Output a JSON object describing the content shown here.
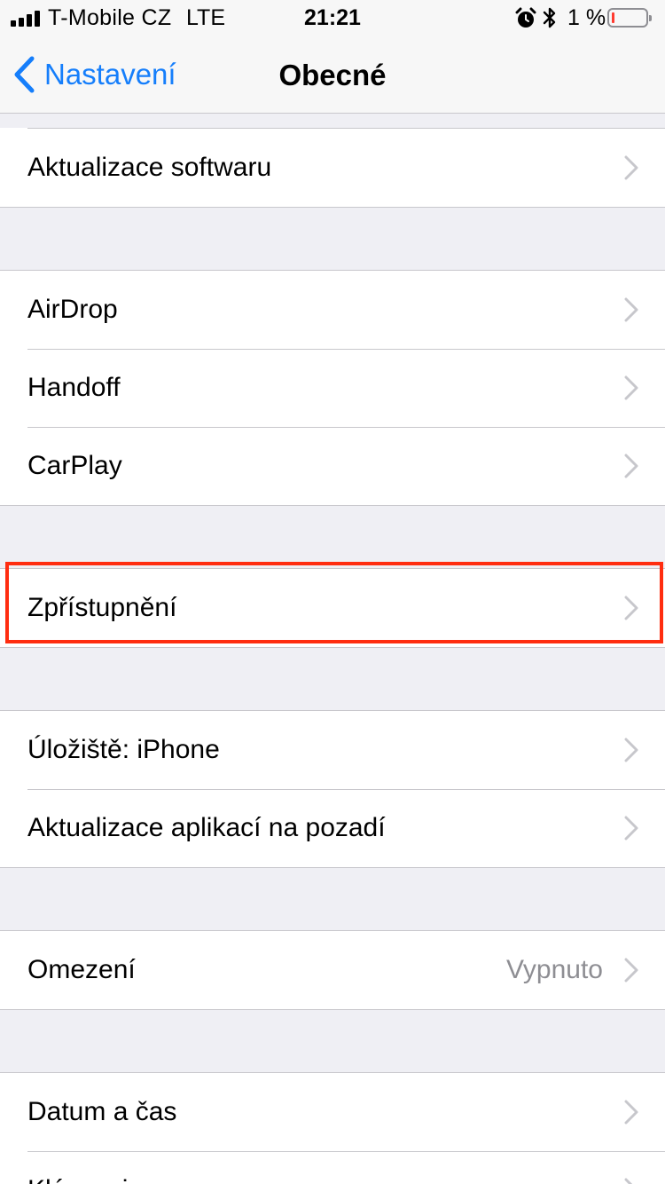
{
  "status_bar": {
    "carrier": "T-Mobile CZ",
    "network": "LTE",
    "time": "21:21",
    "battery_percent": "1 %",
    "icons": [
      "signal-icon",
      "alarm-icon",
      "bluetooth-icon",
      "battery-icon"
    ]
  },
  "nav": {
    "back_label": "Nastavení",
    "title": "Obecné"
  },
  "groups": [
    {
      "items": [
        {
          "label": "Aktualizace softwaru"
        }
      ]
    },
    {
      "items": [
        {
          "label": "AirDrop"
        },
        {
          "label": "Handoff"
        },
        {
          "label": "CarPlay"
        }
      ]
    },
    {
      "items": [
        {
          "label": "Zpřístupnění"
        }
      ]
    },
    {
      "items": [
        {
          "label": "Úložiště: iPhone"
        },
        {
          "label": "Aktualizace aplikací na pozadí"
        }
      ]
    },
    {
      "items": [
        {
          "label": "Omezení",
          "value": "Vypnuto"
        }
      ]
    },
    {
      "items": [
        {
          "label": "Datum a čas"
        },
        {
          "label": "Klávesnice"
        }
      ]
    }
  ],
  "colors": {
    "accent": "#157efb",
    "highlight": "#ff2d10",
    "background": "#efeff4",
    "separator": "#c8c7cc",
    "secondary_text": "#8e8e93"
  }
}
